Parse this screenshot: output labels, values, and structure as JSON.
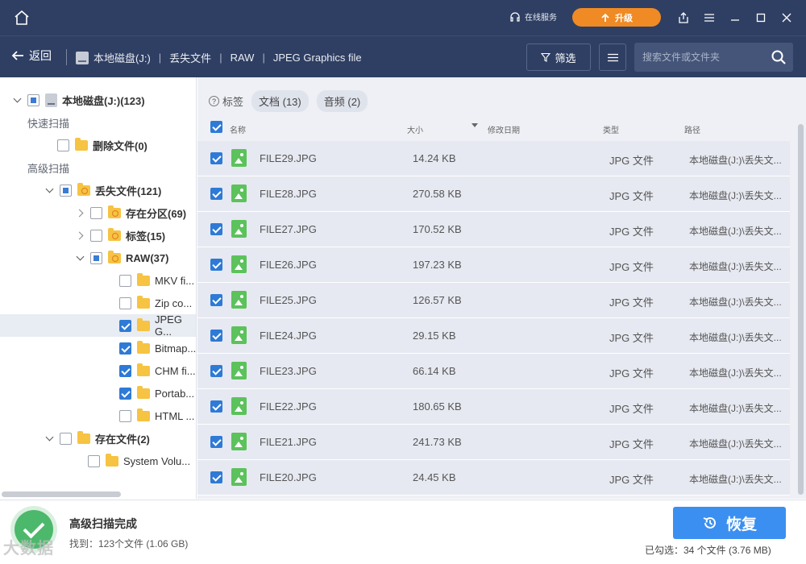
{
  "titlebar": {
    "online_service": "在线服务",
    "upgrade": "升级"
  },
  "nav": {
    "back": "返回",
    "breadcrumbs": [
      "本地磁盘(J:)",
      "丢失文件",
      "RAW",
      "JPEG Graphics file"
    ],
    "filter": "筛选",
    "search_placeholder": "搜索文件或文件夹"
  },
  "sidebar": {
    "root": "本地磁盘(J:)(123)",
    "quick_scan": "快速扫描",
    "deleted_files": "删除文件(0)",
    "advanced_scan": "高级扫描",
    "lost_files": "丢失文件(121)",
    "existing_partition": "存在分区(69)",
    "tags": "标签(15)",
    "raw": "RAW(37)",
    "raw_children": [
      "MKV fi...",
      "Zip co...",
      "JPEG G...",
      "Bitmap...",
      "CHM fi...",
      "Portab...",
      "HTML ..."
    ],
    "existing_files": "存在文件(2)",
    "system_volume": "System Volu..."
  },
  "tags": {
    "label": "标签",
    "documents": "文档 (13)",
    "audio": "音频 (2)"
  },
  "table": {
    "columns": {
      "name": "名称",
      "size": "大小",
      "modified": "修改日期",
      "type": "类型",
      "path": "路径"
    },
    "rows": [
      {
        "name": "FILE29.JPG",
        "size": "14.24 KB",
        "type": "JPG 文件",
        "path": "本地磁盘(J:)\\丢失文..."
      },
      {
        "name": "FILE28.JPG",
        "size": "270.58 KB",
        "type": "JPG 文件",
        "path": "本地磁盘(J:)\\丢失文..."
      },
      {
        "name": "FILE27.JPG",
        "size": "170.52 KB",
        "type": "JPG 文件",
        "path": "本地磁盘(J:)\\丢失文..."
      },
      {
        "name": "FILE26.JPG",
        "size": "197.23 KB",
        "type": "JPG 文件",
        "path": "本地磁盘(J:)\\丢失文..."
      },
      {
        "name": "FILE25.JPG",
        "size": "126.57 KB",
        "type": "JPG 文件",
        "path": "本地磁盘(J:)\\丢失文..."
      },
      {
        "name": "FILE24.JPG",
        "size": "29.15 KB",
        "type": "JPG 文件",
        "path": "本地磁盘(J:)\\丢失文..."
      },
      {
        "name": "FILE23.JPG",
        "size": "66.14 KB",
        "type": "JPG 文件",
        "path": "本地磁盘(J:)\\丢失文..."
      },
      {
        "name": "FILE22.JPG",
        "size": "180.65 KB",
        "type": "JPG 文件",
        "path": "本地磁盘(J:)\\丢失文..."
      },
      {
        "name": "FILE21.JPG",
        "size": "241.73 KB",
        "type": "JPG 文件",
        "path": "本地磁盘(J:)\\丢失文..."
      },
      {
        "name": "FILE20.JPG",
        "size": "24.45 KB",
        "type": "JPG 文件",
        "path": "本地磁盘(J:)\\丢失文..."
      }
    ]
  },
  "footer": {
    "scan_complete": "高级扫描完成",
    "found": "找到：123个文件 (1.06 GB)",
    "recover": "恢复",
    "selected": "已勾选：34 个文件 (3.76 MB)",
    "watermark": "大数据"
  },
  "colors": {
    "header_bg": "#2f3f63",
    "upgrade": "#f08a24",
    "accent": "#2e7ad6",
    "recover": "#3b8ff0",
    "success": "#4cb86b"
  }
}
